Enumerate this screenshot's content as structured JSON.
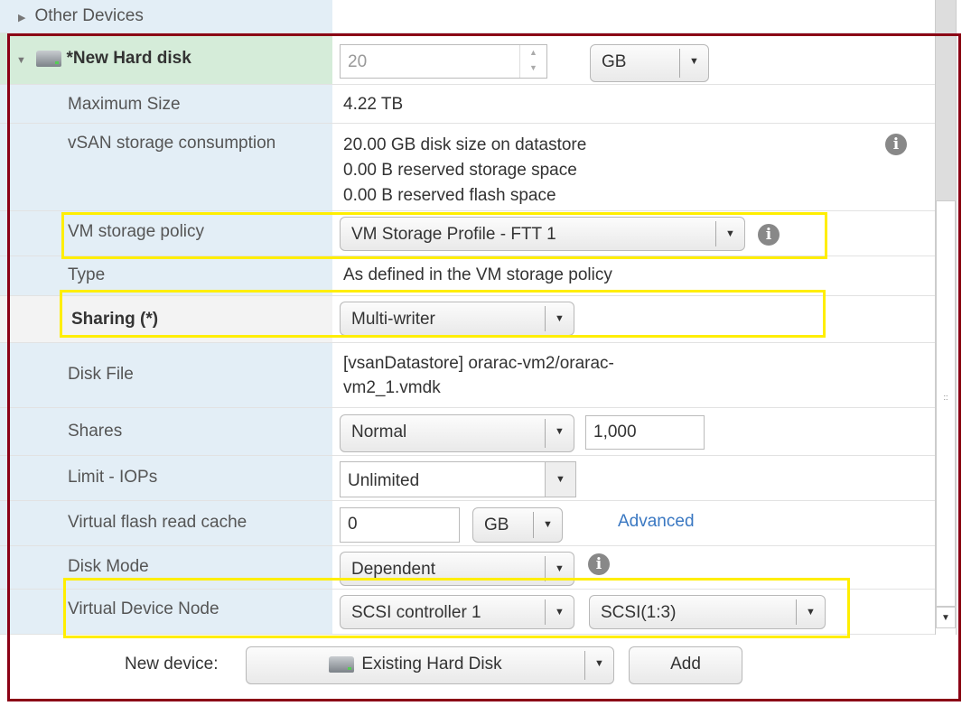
{
  "other_devices": "Other Devices",
  "disk": {
    "title": "*New Hard disk",
    "size_value": "20",
    "size_unit": "GB"
  },
  "rows": {
    "max_size": {
      "label": "Maximum Size",
      "value": "4.22 TB"
    },
    "vsan": {
      "label": "vSAN storage consumption",
      "lines": [
        "20.00 GB disk size on datastore",
        "0.00 B reserved storage space",
        "0.00 B reserved flash space"
      ]
    },
    "policy": {
      "label": "VM storage policy",
      "value": "VM Storage Profile - FTT 1"
    },
    "type": {
      "label": "Type",
      "value": "As defined in the VM storage policy"
    },
    "sharing": {
      "label": "Sharing (*)",
      "value": "Multi-writer"
    },
    "disk_file": {
      "label": "Disk File",
      "lines": [
        "[vsanDatastore] orarac-vm2/orarac-",
        "vm2_1.vmdk"
      ]
    },
    "shares": {
      "label": "Shares",
      "value": "Normal",
      "amount": "1,000"
    },
    "limit": {
      "label": "Limit - IOPs",
      "value": "Unlimited"
    },
    "vflash": {
      "label": "Virtual flash read cache",
      "value": "0",
      "unit": "GB",
      "link": "Advanced"
    },
    "disk_mode": {
      "label": "Disk Mode",
      "value": "Dependent"
    },
    "vdn": {
      "label": "Virtual Device Node",
      "controller": "SCSI controller 1",
      "node": "SCSI(1:3)"
    }
  },
  "footer": {
    "label": "New device:",
    "device": "Existing Hard Disk",
    "add": "Add"
  },
  "colors": {
    "frame": "#8b0015",
    "highlight": "#ffee00",
    "link": "#3a78c2"
  }
}
